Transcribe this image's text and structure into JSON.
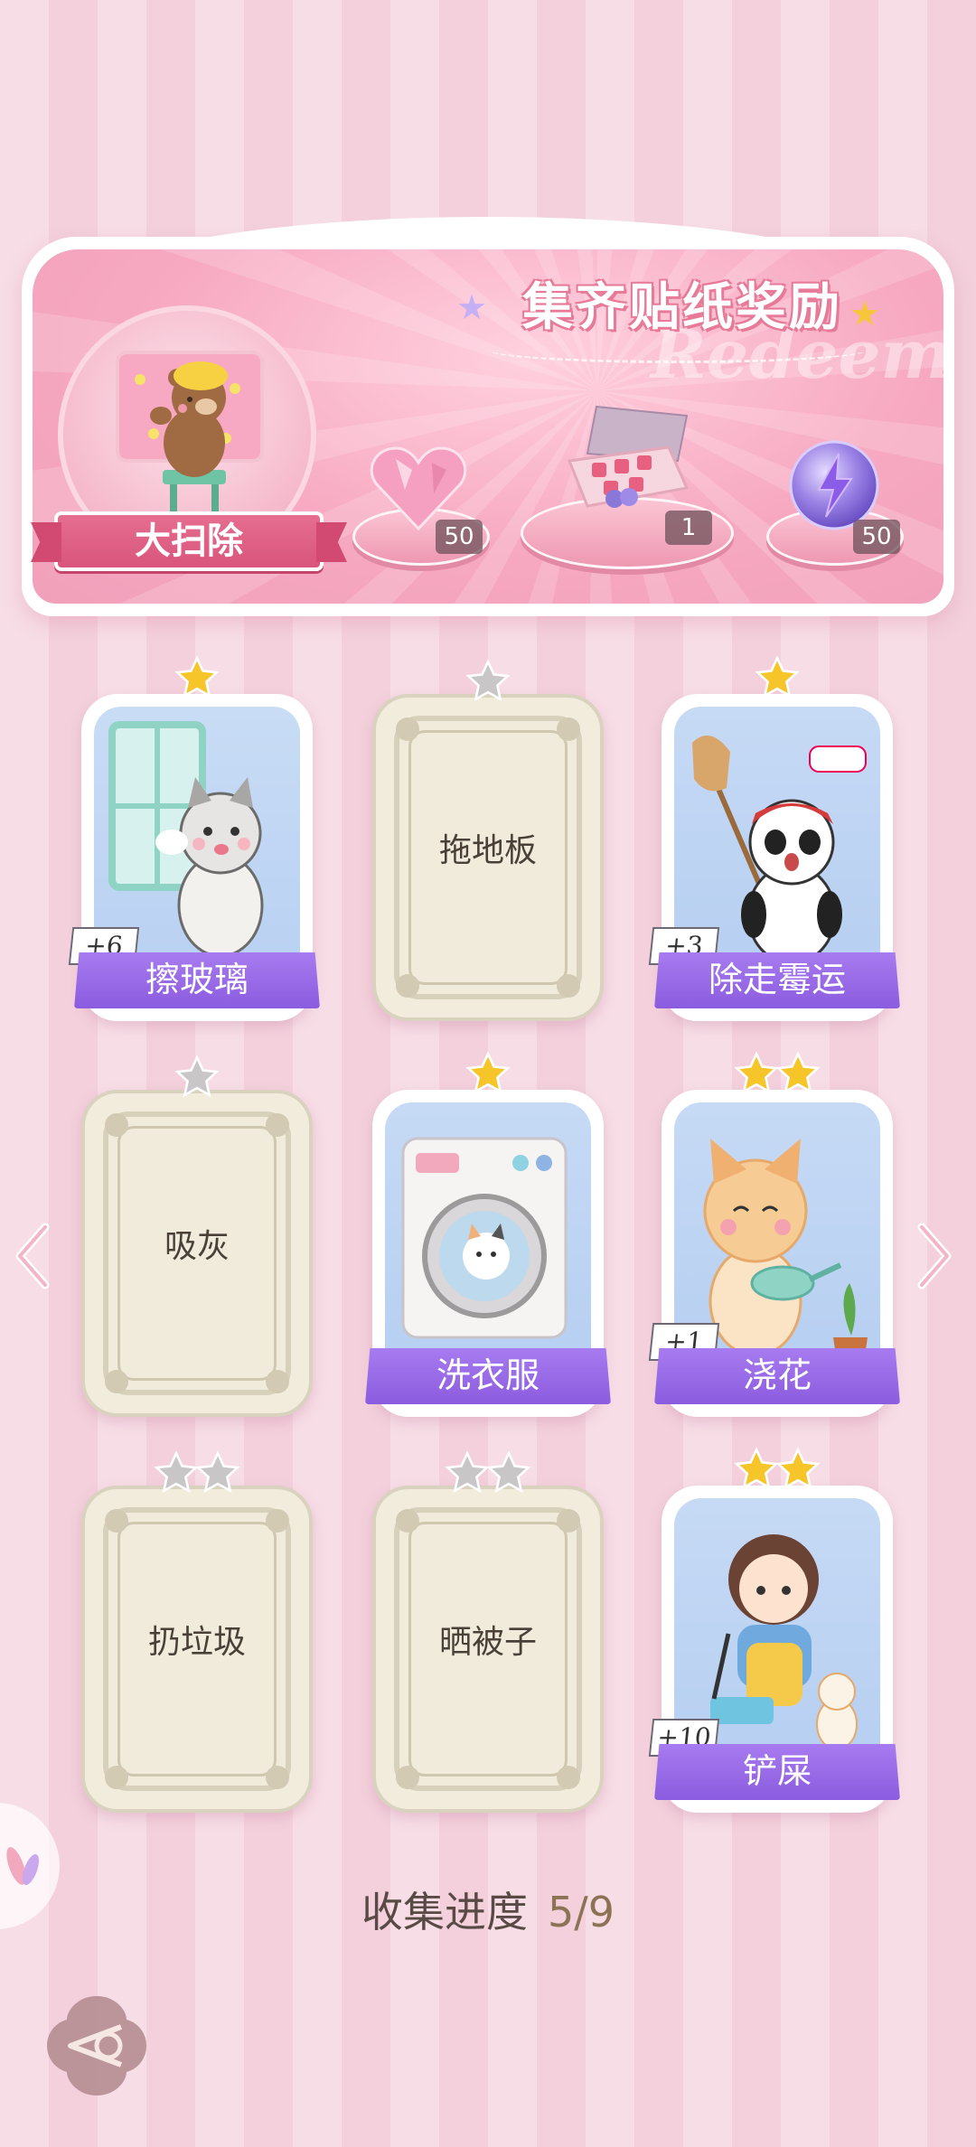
{
  "banner": {
    "title": "集齐贴纸奖励",
    "subtitle": "Redeem",
    "medal_label": "大扫除",
    "rewards": [
      {
        "name": "heart-gem",
        "count": "50"
      },
      {
        "name": "gift-box",
        "count": "1"
      },
      {
        "name": "energy-orb",
        "count": "50"
      }
    ]
  },
  "cards": [
    {
      "label": "擦玻璃",
      "stars": 1,
      "collected": true,
      "bonus": "+6",
      "art": "cat-window"
    },
    {
      "label": "拖地板",
      "stars": 1,
      "collected": false
    },
    {
      "label": "除走霉运",
      "stars": 1,
      "collected": true,
      "bonus": "+3",
      "art": "panda-broom"
    },
    {
      "label": "吸灰",
      "stars": 1,
      "collected": false
    },
    {
      "label": "洗衣服",
      "stars": 1,
      "collected": true,
      "art": "washing-machine"
    },
    {
      "label": "浇花",
      "stars": 2,
      "collected": true,
      "bonus": "+1",
      "art": "cat-watering"
    },
    {
      "label": "扔垃圾",
      "stars": 2,
      "collected": false
    },
    {
      "label": "晒被子",
      "stars": 2,
      "collected": false
    },
    {
      "label": "铲屎",
      "stars": 2,
      "collected": true,
      "bonus": "+10",
      "art": "girl-litter"
    }
  ],
  "progress": {
    "label": "收集进度",
    "value": "5/9"
  },
  "colors": {
    "accent": "#8b5cdf",
    "pink": "#f1a0ba",
    "gold": "#f5c52a",
    "silver": "#c9c6c8"
  }
}
